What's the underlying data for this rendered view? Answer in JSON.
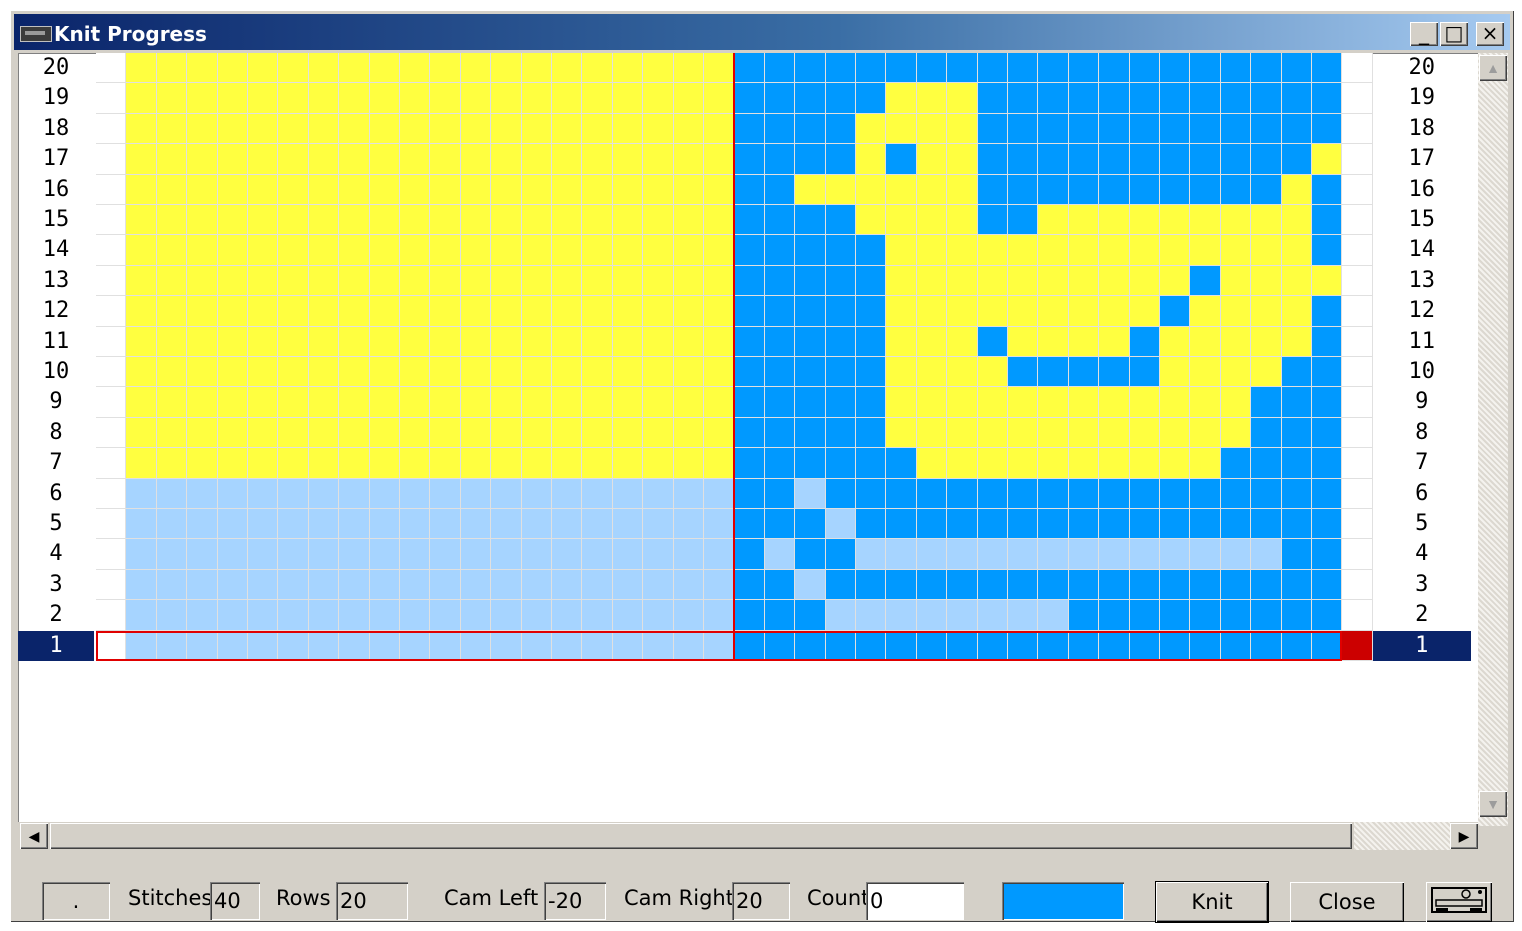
{
  "window": {
    "title": "Knit Progress",
    "controls": {
      "minimize": "_",
      "maximize": "□",
      "close": "×"
    }
  },
  "grid": {
    "rows_total": 20,
    "stitches": 40,
    "current_row": 1,
    "colors": {
      "yellow": "#ffff40",
      "blue": "#0099ff",
      "light": "#a6d4ff",
      "white": "#ffffff",
      "marker_red": "#cc0000",
      "active_row_bg": "#0a246a",
      "current_row_outline": "#e00000"
    },
    "left_labels": [
      "20",
      "19",
      "18",
      "17",
      "16",
      "15",
      "14",
      "13",
      "12",
      "11",
      "10",
      "9",
      "8",
      "7",
      "6",
      "5",
      "4",
      "3",
      "2",
      "1"
    ],
    "right_labels": [
      "20",
      "19",
      "18",
      "17",
      "16",
      "15",
      "14",
      "13",
      "12",
      "11",
      "10",
      "9",
      "8",
      "7",
      "6",
      "5",
      "4",
      "3",
      "2",
      "1"
    ],
    "pattern_rows": [
      "BBBBBBBBBBBBBBBBBBBB",
      "BBBBBYYYBBBBBBBBBBBB",
      "BBBBYYYYBBBBBBBBBBBB",
      "BBBBYBYYBBBBBBBBBBBY",
      "BBYYYYYYBBBBBBBBBBYB",
      "BBBBYYYYBBYYYYYYYYYB",
      "BBBBBYYYYYYYYYYYYYYB",
      "BBBBBYYYYYYYYYYBYYYY",
      "BBBBBYYYYYYYYYBYYYYB",
      "BBBBBYYYBYYYYBYYYYYB",
      "BBBBBYYYYBBBBBYYYYBB",
      "BBBBBYYYYYYYYYYYYBBB",
      "BBBBBYYYYYYYYYYYYBBB",
      "BBBBBBYYYYYYYYYYBBBB",
      "BBLBBBBBBBBBBBBBBBBB",
      "BBBLBBBBBBBBBBBBBBBB",
      "BLBBLLLLLLLLLLLLLLBB",
      "BBLBBBBBBBBBBBBBBBBB",
      "BBBLLLLLLLLBBBBBBBBB",
      "BBBBBBBBBBBBBBBBBBBB"
    ]
  },
  "status": {
    "indicator": ".",
    "stitches_label": "Stitches",
    "stitches_value": "40",
    "rows_label": "Rows",
    "rows_value": "20",
    "cam_left_label": "Cam Left",
    "cam_left_value": "-20",
    "cam_right_label": "Cam Right",
    "cam_right_value": "20",
    "count_label": "Count",
    "count_value": "0",
    "color_swatch": "#0099ff",
    "knit_button": "Knit",
    "close_button": "Close",
    "machine_icon": "knitting-machine-icon"
  }
}
